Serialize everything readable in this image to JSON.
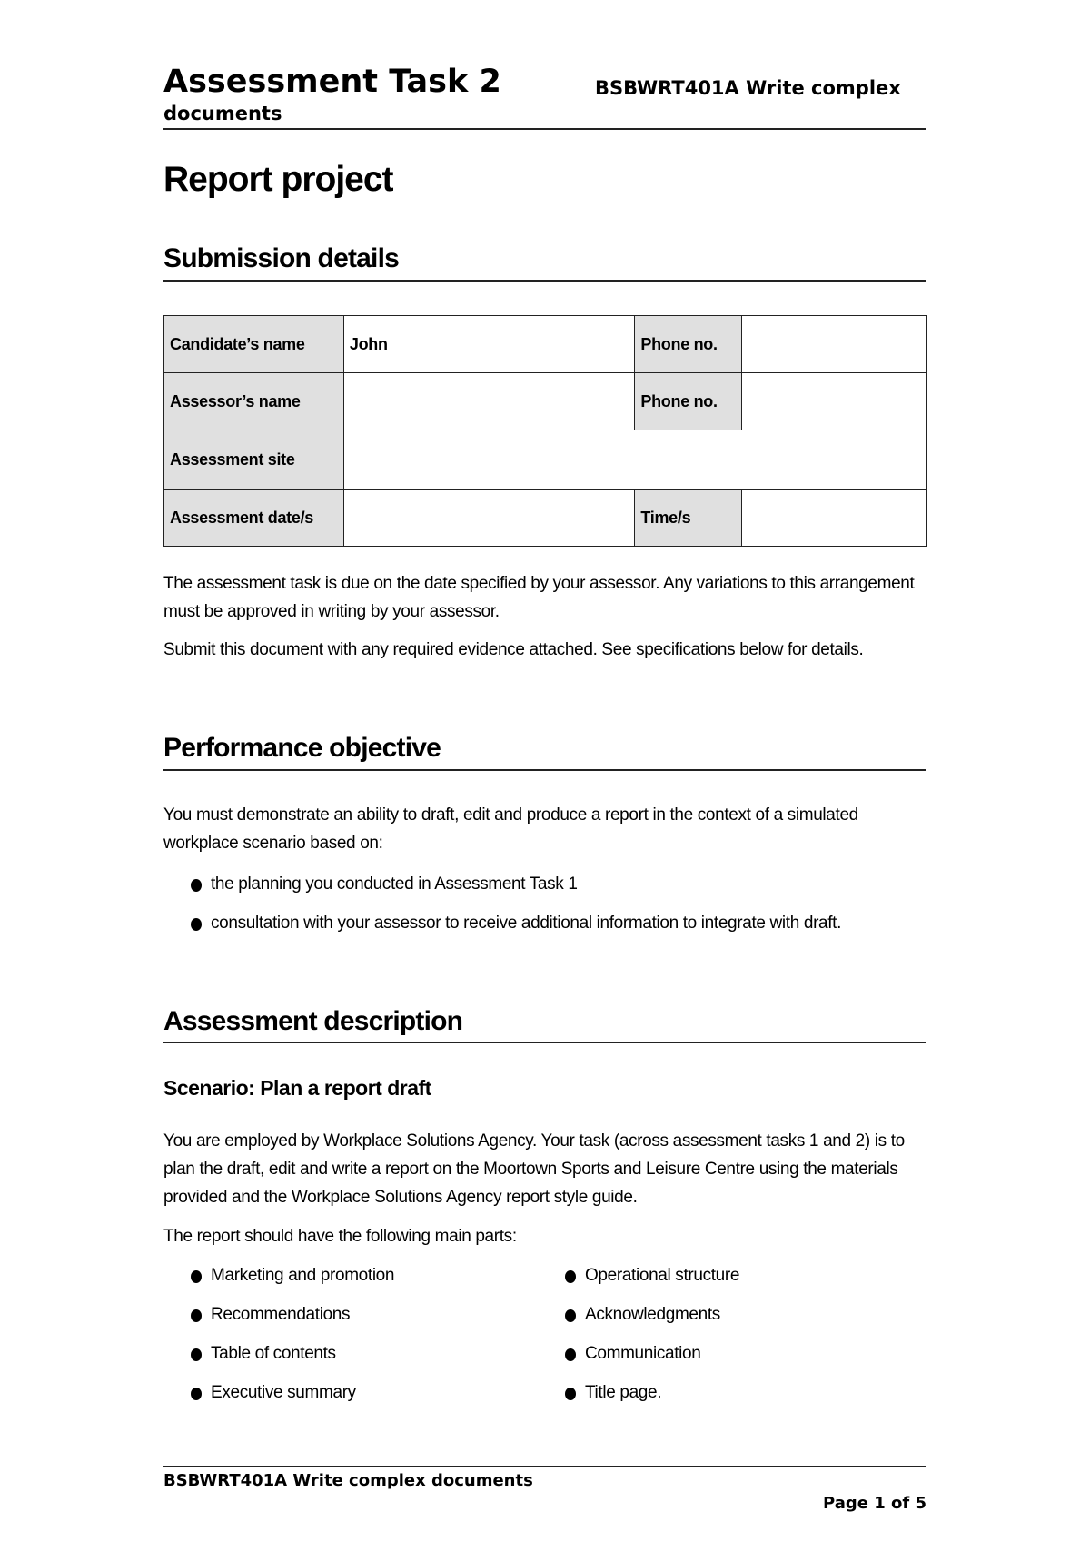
{
  "header": {
    "title": "Assessment Task 2",
    "unit_line1": "BSBWRT401A Write complex",
    "unit_line2": "documents"
  },
  "page_title": "Report project",
  "submission": {
    "heading": "Submission details",
    "table": {
      "candidate_name_label": "Candidate’s name",
      "candidate_name_value": "John",
      "candidate_phone_label": "Phone no.",
      "candidate_phone_value": "",
      "assessor_name_label": "Assessor’s name",
      "assessor_name_value": "",
      "assessor_phone_label": "Phone no.",
      "assessor_phone_value": "",
      "site_label": "Assessment site",
      "site_value": "",
      "date_label": "Assessment date/s",
      "date_value": "",
      "time_label": "Time/s",
      "time_value": ""
    },
    "paragraphs": [
      "The assessment task is due on the date specified by your assessor. Any variations to this arrangement must be approved in writing by your assessor.",
      "Submit this document with any required evidence attached. See specifications below for details."
    ]
  },
  "performance": {
    "heading": "Performance objective",
    "intro": "You must demonstrate an ability to draft, edit and produce a report in the context of a simulated workplace scenario based on:",
    "bullets": [
      "the planning you conducted in Assessment Task 1",
      "consultation with your assessor to receive additional information to integrate with draft."
    ]
  },
  "description": {
    "heading": "Assessment description",
    "subheading": "Scenario: Plan a report draft",
    "paragraph": "You are employed by Workplace Solutions Agency. Your task (across assessment tasks 1 and 2) is to plan the draft, edit and write a report on the Moortown Sports and Leisure Centre using the materials provided and the Workplace Solutions Agency report style guide.",
    "parts_intro": "The report should have the following main parts:",
    "parts_left": [
      "Marketing and promotion",
      "Recommendations",
      "Table of contents",
      "Executive summary"
    ],
    "parts_right": [
      "Operational structure",
      "Acknowledgments",
      "Communication",
      "Title page."
    ]
  },
  "footer": {
    "unit": "BSBWRT401A Write complex documents",
    "page": "Page 1 of 5"
  }
}
